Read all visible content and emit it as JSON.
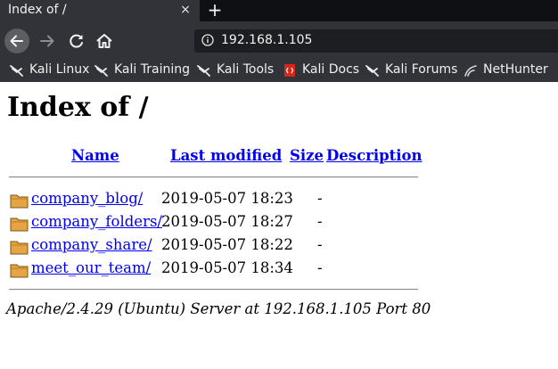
{
  "browser": {
    "tab": {
      "title": "Index of /",
      "close_symbol": "×"
    },
    "new_tab_symbol": "+",
    "url": "192.168.1.105",
    "bookmarks": [
      {
        "label": "Kali Linux",
        "icon": "kali-dragon-icon"
      },
      {
        "label": "Kali Training",
        "icon": "kali-dragon-icon"
      },
      {
        "label": "Kali Tools",
        "icon": "kali-dragon-icon"
      },
      {
        "label": "Kali Docs",
        "icon": "kali-docs-icon"
      },
      {
        "label": "Kali Forums",
        "icon": "kali-dragon-icon"
      },
      {
        "label": "NetHunter",
        "icon": "nethunter-icon"
      }
    ]
  },
  "page": {
    "title": "Index of /",
    "headers": {
      "name": "Name",
      "last_modified": "Last modified",
      "size": "Size",
      "description": "Description"
    },
    "entries": [
      {
        "name": "company_blog/",
        "modified": "2019-05-07 18:23",
        "size": "-",
        "description": ""
      },
      {
        "name": "company_folders/",
        "modified": "2019-05-07 18:27",
        "size": "-",
        "description": ""
      },
      {
        "name": "company_share/",
        "modified": "2019-05-07 18:22",
        "size": "-",
        "description": ""
      },
      {
        "name": "meet_our_team/",
        "modified": "2019-05-07 18:34",
        "size": "-",
        "description": ""
      }
    ],
    "server_signature": "Apache/2.4.29 (Ubuntu) Server at 192.168.1.105 Port 80"
  },
  "colors": {
    "chrome_dark": "#0f1013",
    "chrome_toolbar": "#313338",
    "link": "#0000ee",
    "folder": "#e6a545",
    "kali_docs_red": "#d9261c"
  }
}
